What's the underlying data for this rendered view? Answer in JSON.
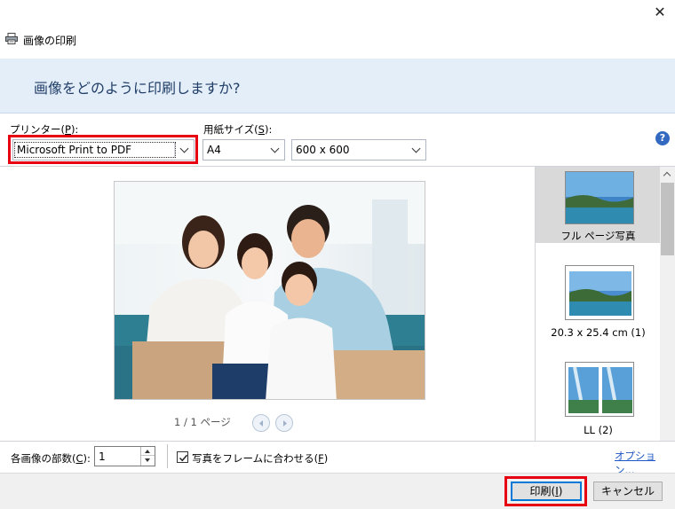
{
  "window": {
    "title": "画像の印刷",
    "close_glyph": "✕"
  },
  "banner": {
    "heading": "画像をどのように印刷しますか?"
  },
  "printer": {
    "label": "プリンター(P):",
    "label_text": "プリンター(",
    "label_key": "P",
    "label_end": "):",
    "value": "Microsoft Print to PDF"
  },
  "paper": {
    "label_text": "用紙サイズ(",
    "label_key": "S",
    "label_end": "):",
    "size_value": "A4",
    "resolution_value": "600 x 600"
  },
  "help": {
    "glyph": "?"
  },
  "preview": {
    "page_indicator": "1 / 1 ページ"
  },
  "layouts": [
    {
      "label": "フル ページ写真",
      "selected": true
    },
    {
      "label": "20.3 x 25.4 cm (1)",
      "selected": false
    },
    {
      "label": "LL (2)",
      "selected": false
    }
  ],
  "copies": {
    "label_text": "各画像の部数(",
    "label_key": "C",
    "label_end": "):",
    "value": "1"
  },
  "fit_frame": {
    "label_text": "写真をフレームに合わせる(",
    "label_key": "F",
    "label_end": ")",
    "checked": true
  },
  "options_link": "オプション...",
  "buttons": {
    "print_text": "印刷(",
    "print_key": "I",
    "print_end": ")",
    "cancel": "キャンセル"
  },
  "colors": {
    "highlight": "#e60012",
    "banner_bg": "#e4eef9",
    "link": "#1d56c5",
    "help_icon": "#3469c1"
  }
}
